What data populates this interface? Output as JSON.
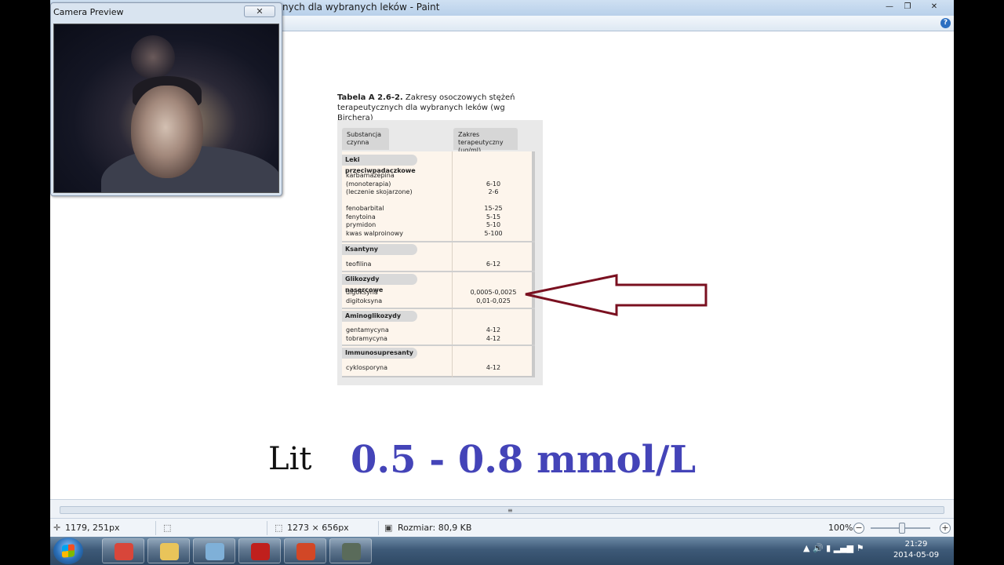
{
  "window": {
    "title": "nych dla wybranych leków - Paint",
    "minimize": "—",
    "maximize": "❐",
    "close": "✕",
    "help": "?"
  },
  "camera": {
    "title": "Camera Preview",
    "close": "✕"
  },
  "document": {
    "caption_bold": "Tabela A 2.6-2.",
    "caption_rest": " Zakresy osoczowych stężeń terapeutycznych dla wybranych leków (wg Birchera)",
    "col1_header": "Substancja\nczynna",
    "col2_header": "Zakres terapeutyczny\n(µg/ml)",
    "groups": [
      {
        "name": "Leki przeciwpadaczkowe"
      },
      {
        "name": "Ksantyny"
      },
      {
        "name": "Glikozydy nasercowe"
      },
      {
        "name": "Aminoglikozydy"
      },
      {
        "name": "Immunosupresanty"
      }
    ],
    "rows": [
      {
        "drug": "karbamazepina",
        "value": ""
      },
      {
        "drug": "(monoterapia)",
        "value": "6-10"
      },
      {
        "drug": "(leczenie skojarzone)",
        "value": "2-6"
      },
      {
        "drug": "fenobarbital",
        "value": "15-25"
      },
      {
        "drug": "fenytoina",
        "value": "5-15"
      },
      {
        "drug": "prymidon",
        "value": "5-10"
      },
      {
        "drug": "kwas walproinowy",
        "value": "5-100"
      },
      {
        "drug": "teofilina",
        "value": "6-12"
      },
      {
        "drug": "digoksyna",
        "value": "0,0005-0,0025"
      },
      {
        "drug": "digitoksyna",
        "value": "0,01-0,025"
      },
      {
        "drug": "gentamycyna",
        "value": "4-12"
      },
      {
        "drug": "tobramycyna",
        "value": "4-12"
      },
      {
        "drug": "cyklosporyna",
        "value": "4-12"
      }
    ],
    "arrow_color": "#7a1020"
  },
  "annotation": {
    "label": "Lit",
    "value": "0.5 - 0.8 mmol/L",
    "value_color": "#4444b8"
  },
  "statusbar": {
    "cursor_pos": "1179, 251px",
    "image_size": "1273 × 656px",
    "file_size": "Rozmiar: 80,9 KB",
    "zoom": "100%",
    "zoom_out": "−",
    "zoom_in": "+"
  },
  "taskbar": {
    "apps": [
      {
        "name": "chrome-icon",
        "color": "#d8463a"
      },
      {
        "name": "explorer-icon",
        "color": "#e9c45a"
      },
      {
        "name": "paint-icon",
        "color": "#7fb0d8"
      },
      {
        "name": "acrobat-icon",
        "color": "#c0201d"
      },
      {
        "name": "powerpoint-icon",
        "color": "#d24726"
      },
      {
        "name": "camera-app-icon",
        "color": "#5a6b5a"
      }
    ],
    "tray_icons": "▲  🔊  ▮  ▂▄▆  ⚑",
    "time": "21:29",
    "date": "2014-05-09"
  }
}
